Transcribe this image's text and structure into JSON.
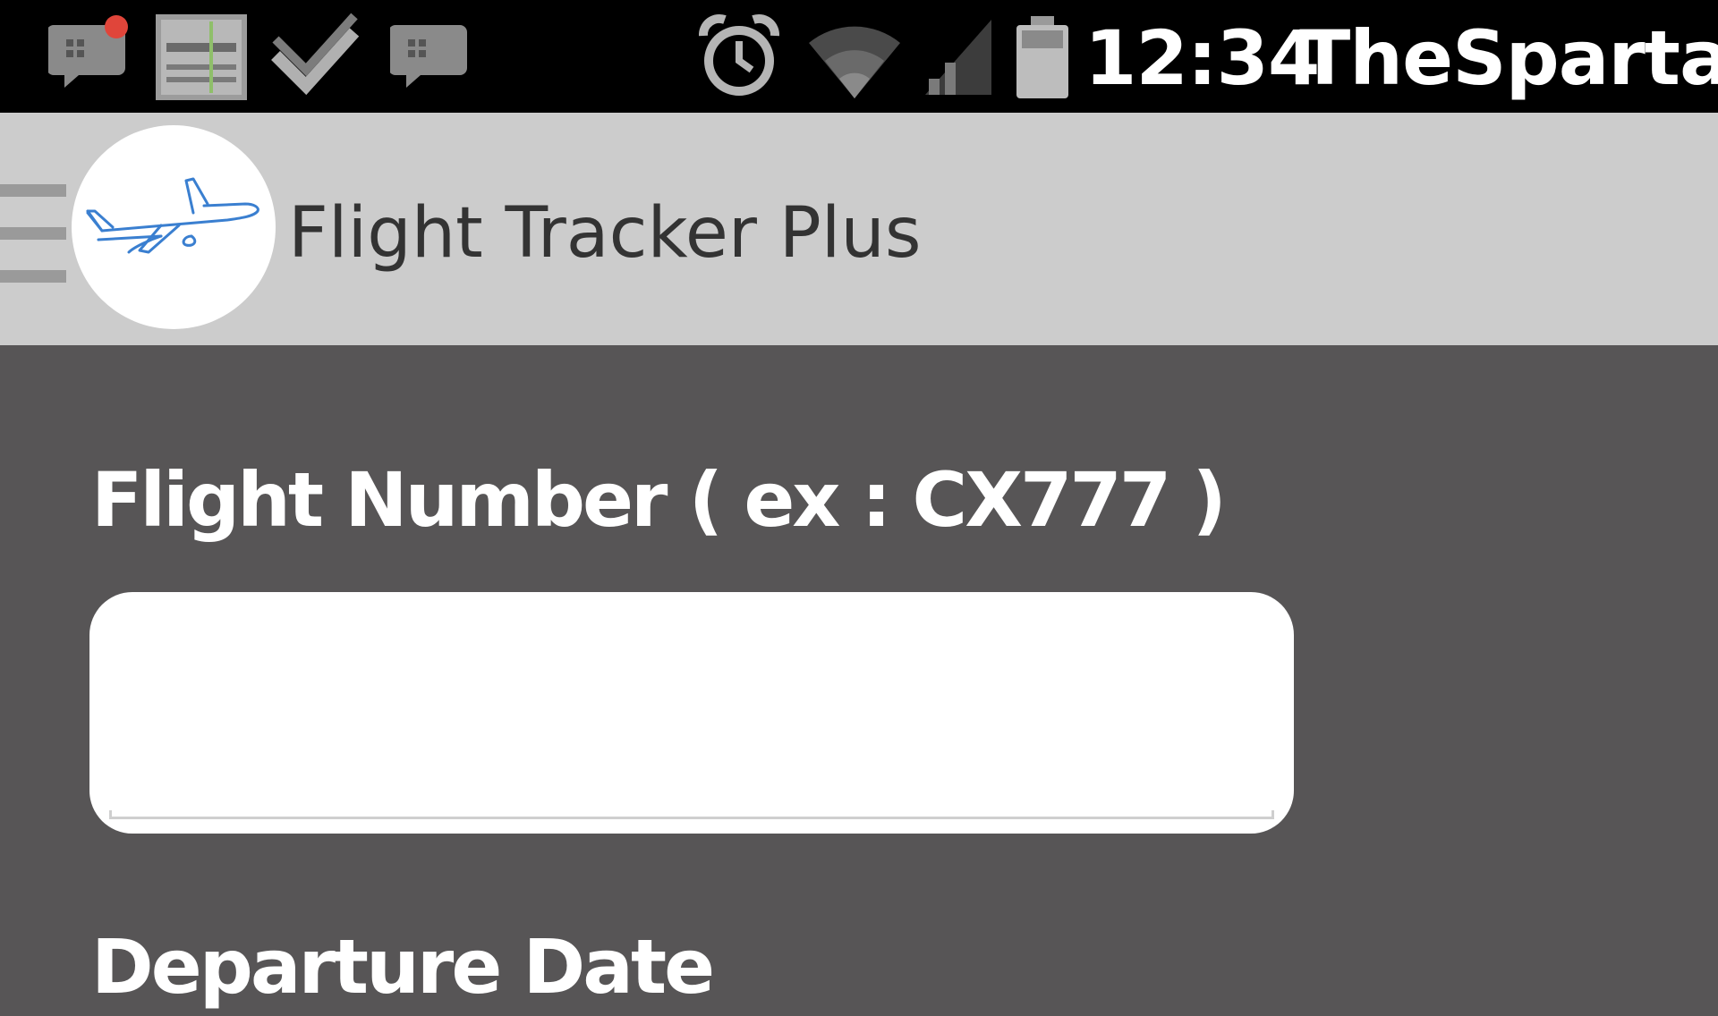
{
  "status_bar": {
    "left_icons": [
      "bbm-notification-icon",
      "app-badge-icon",
      "check-icon",
      "bbm-icon"
    ],
    "right_icons": [
      "alarm-icon",
      "wifi-icon",
      "signal-icon",
      "battery-icon"
    ],
    "time": "12:34",
    "carrier": "TheSpartas"
  },
  "app_bar": {
    "menu_icon": "hamburger-icon",
    "logo_icon": "airplane-icon",
    "title": "Flight Tracker Plus"
  },
  "form": {
    "flight_number_label": "Flight Number ( ex : CX777 )",
    "flight_number_value": "",
    "departure_date_label": "Departure Date"
  },
  "colors": {
    "status_bar_bg": "#000000",
    "app_bar_bg": "#cccccc",
    "content_bg": "#575556",
    "input_bg": "#ffffff",
    "logo_stroke": "#3a7fd0"
  }
}
